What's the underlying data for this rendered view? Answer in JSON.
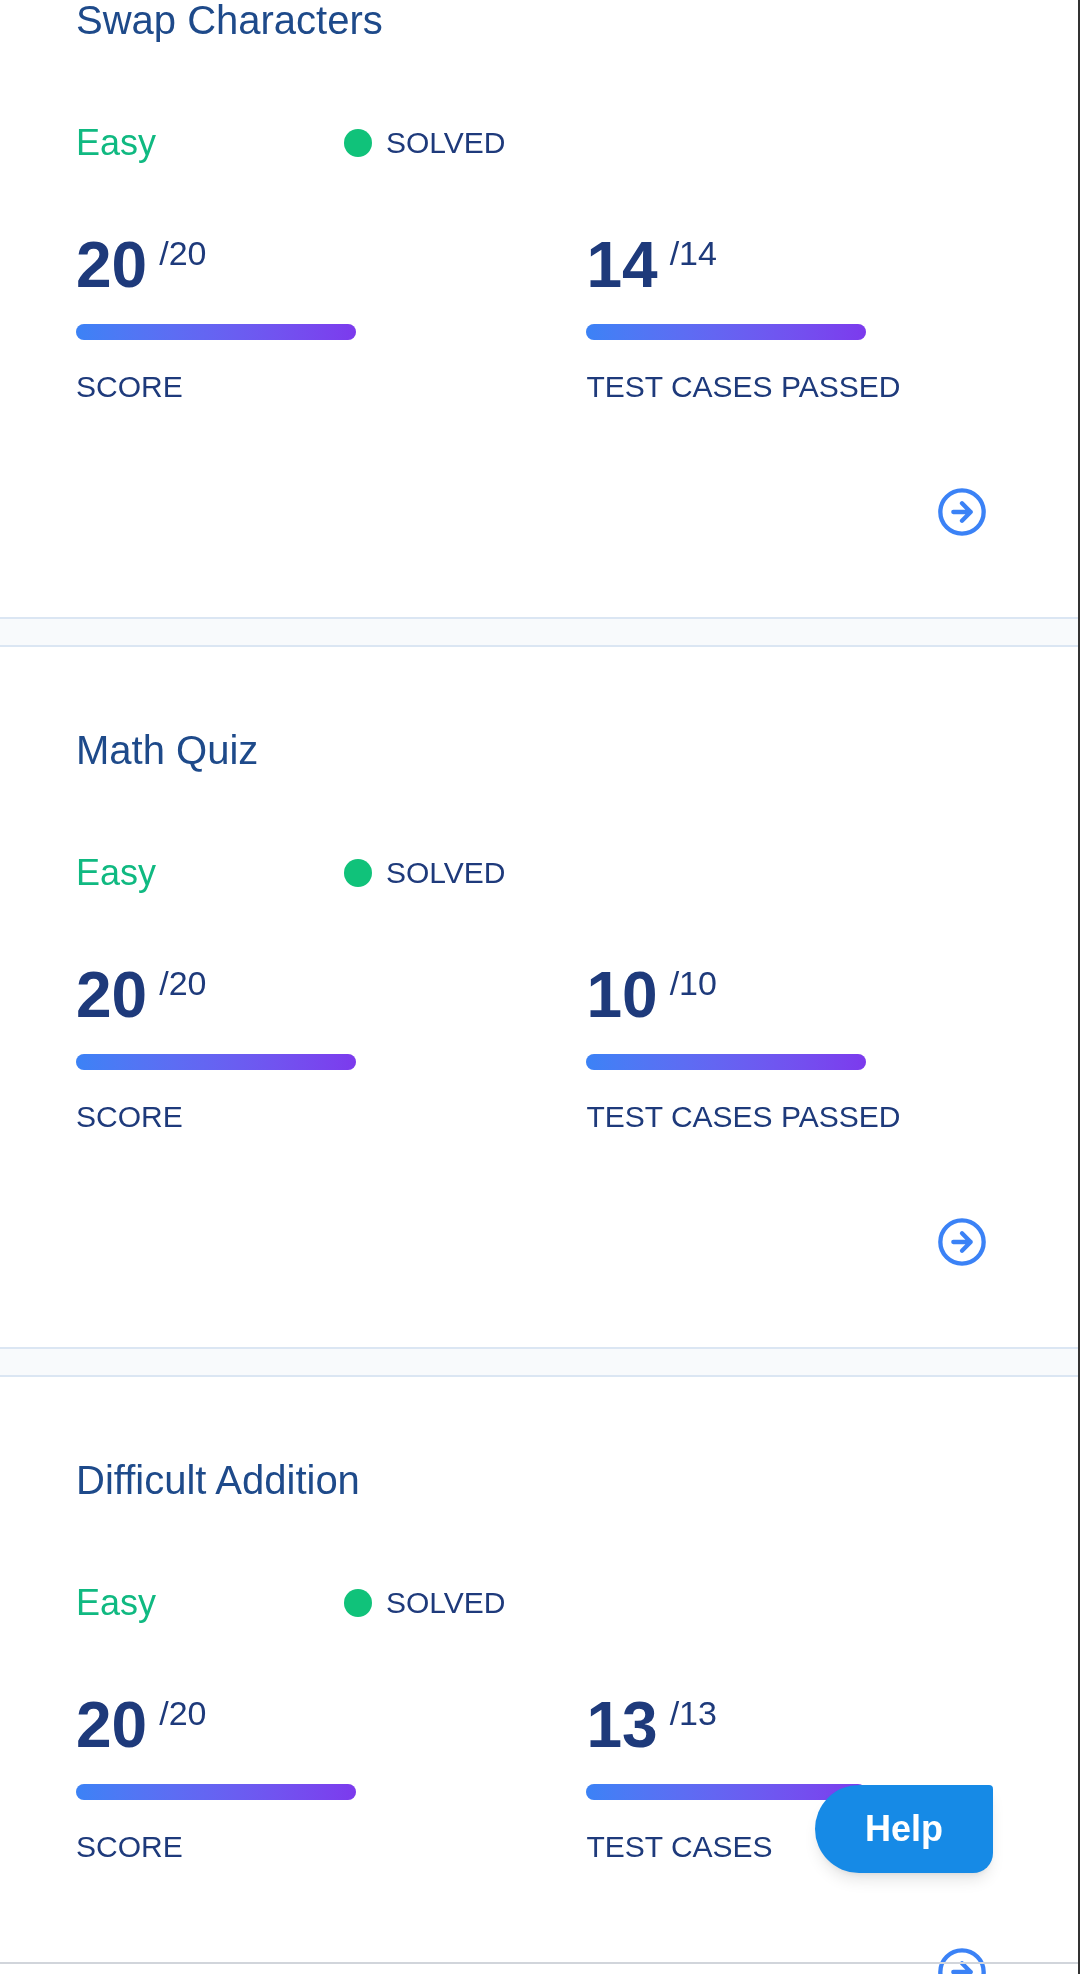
{
  "problems": [
    {
      "title": "Swap Characters",
      "difficulty": "Easy",
      "status": "SOLVED",
      "solved": true,
      "score": {
        "value": "20",
        "total": "/20",
        "level": 1,
        "label": "SCORE"
      },
      "tests": {
        "value": "14",
        "total": "/14",
        "level": 1,
        "label": "TEST CASES PASSED"
      }
    },
    {
      "title": "Math Quiz",
      "difficulty": "Easy",
      "status": "SOLVED",
      "solved": true,
      "score": {
        "value": "20",
        "total": "/20",
        "level": 1,
        "label": "SCORE"
      },
      "tests": {
        "value": "10",
        "total": "/10",
        "level": 1,
        "label": "TEST CASES PASSED"
      }
    },
    {
      "title": "Difficult Addition",
      "difficulty": "Easy",
      "status": "SOLVED",
      "solved": true,
      "score": {
        "value": "20",
        "total": "/20",
        "level": 1,
        "label": "SCORE"
      },
      "tests": {
        "value": "13",
        "total": "/13",
        "level": 1,
        "label": "TEST CASES"
      }
    }
  ],
  "help_button": "Help"
}
